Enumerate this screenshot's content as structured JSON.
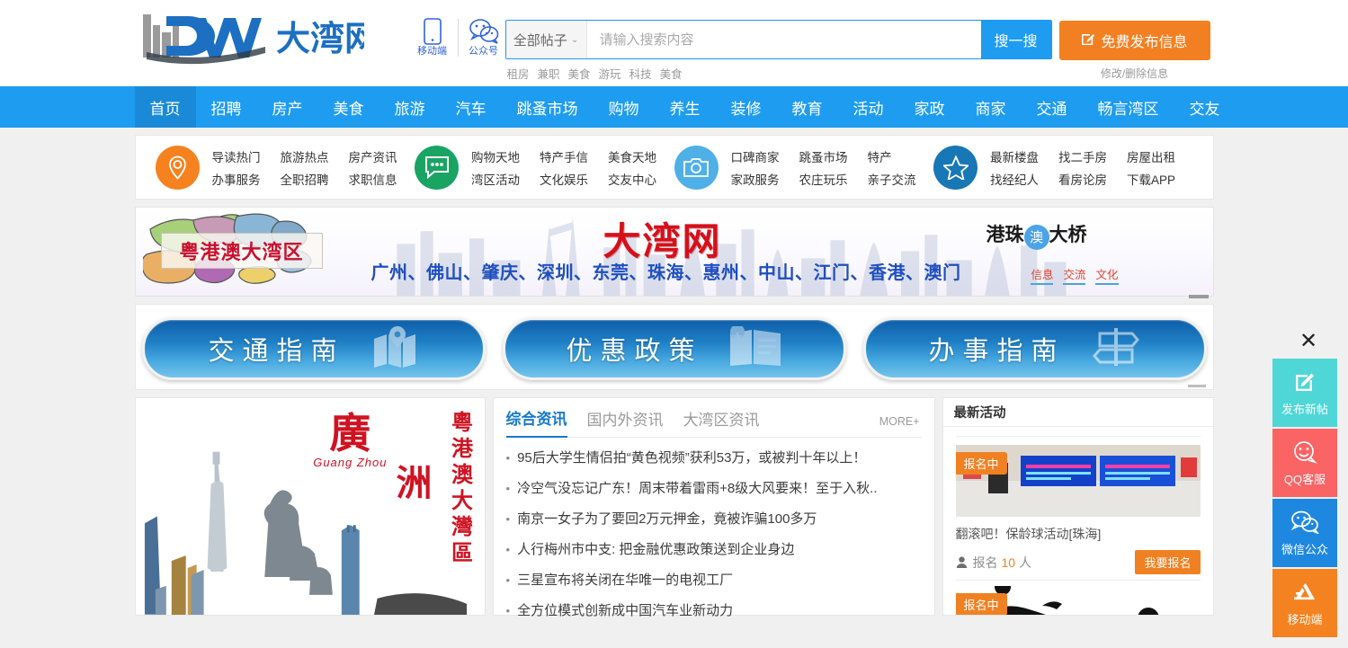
{
  "header": {
    "logo_text": "大湾网",
    "logo_mark": "DW",
    "qr_items": [
      {
        "label": "移动端",
        "icon": "mobile-phone-icon"
      },
      {
        "label": "公众号",
        "icon": "wechat-icon"
      }
    ],
    "search": {
      "category": "全部帖子",
      "placeholder": "请输入搜索内容",
      "value": "",
      "button": "搜一搜",
      "hot_words": [
        "租房",
        "兼职",
        "美食",
        "游玩",
        "科技",
        "美食"
      ]
    },
    "publish": {
      "button": "免费发布信息",
      "sub_link": "修改/删除信息"
    }
  },
  "nav": {
    "items": [
      {
        "label": "首页",
        "active": true
      },
      {
        "label": "招聘",
        "active": false
      },
      {
        "label": "房产",
        "active": false
      },
      {
        "label": "美食",
        "active": false
      },
      {
        "label": "旅游",
        "active": false
      },
      {
        "label": "汽车",
        "active": false
      },
      {
        "label": "跳蚤市场",
        "active": false
      },
      {
        "label": "购物",
        "active": false
      },
      {
        "label": "养生",
        "active": false
      },
      {
        "label": "装修",
        "active": false
      },
      {
        "label": "教育",
        "active": false
      },
      {
        "label": "活动",
        "active": false
      },
      {
        "label": "家政",
        "active": false
      },
      {
        "label": "商家",
        "active": false
      },
      {
        "label": "交通",
        "active": false
      },
      {
        "label": "畅言湾区",
        "active": false
      },
      {
        "label": "交友",
        "active": false
      }
    ]
  },
  "quick_links": {
    "groups": [
      {
        "icon": "location-pin-icon",
        "color": "#f5821f",
        "links": [
          "导读热门",
          "旅游热点",
          "房产资讯",
          "办事服务",
          "全职招聘",
          "求职信息"
        ]
      },
      {
        "icon": "chat-bubble-icon",
        "color": "#19a463",
        "links": [
          "购物天地",
          "特产手信",
          "美食天地",
          "湾区活动",
          "文化娱乐",
          "交友中心"
        ]
      },
      {
        "icon": "camera-icon",
        "color": "#4fb0e8",
        "links": [
          "口碑商家",
          "跳蚤市场",
          "特产",
          "家政服务",
          "农庄玩乐",
          "亲子交流"
        ]
      },
      {
        "icon": "star-icon",
        "color": "#1877b5",
        "links": [
          "最新楼盘",
          "找二手房",
          "房屋出租",
          "找经纪人",
          "看房论房",
          "下载APP"
        ]
      }
    ]
  },
  "banner": {
    "plaque_text": "粤港澳大湾区",
    "title": "大湾网",
    "cities": "广州、佛山、肇庆、深圳、东莞、珠海、惠州、中山、江门、香港、澳门",
    "bridge_brand_1": "港珠",
    "bridge_badge": "澳",
    "bridge_brand_2": "大桥",
    "bridge_links": [
      "信息",
      "交流",
      "文化"
    ]
  },
  "big_buttons": [
    {
      "label": "交通指南",
      "icon": "map-icon"
    },
    {
      "label": "优惠政策",
      "icon": "badge-document-icon"
    },
    {
      "label": "办事指南",
      "icon": "signpost-icon"
    }
  ],
  "left_feature": {
    "city_name": "廣",
    "city_name_2": "洲",
    "pinyin": "Guang Zhou",
    "vertical_text": "粵港澳大灣區"
  },
  "news": {
    "tabs": [
      {
        "label": "综合资讯",
        "active": true
      },
      {
        "label": "国内外资讯",
        "active": false
      },
      {
        "label": "大湾区资讯",
        "active": false
      }
    ],
    "more": "MORE+",
    "items": [
      "95后大学生情侣拍“黄色视频”获利53万，或被判十年以上！",
      "冷空气没忘记广东！周末带着雷雨+8级大风要来！至于入秋..",
      "南京一女子为了要回2万元押金，竟被诈骗100多万",
      "人行梅州市中支: 把金融优惠政策送到企业身边",
      "三星宣布将关闭在华唯一的电视工厂",
      "全方位模式创新成中国汽车业新动力"
    ]
  },
  "activity": {
    "panel_title": "最新活动",
    "cards": [
      {
        "badge": "报名中",
        "title": "翻滚吧！保龄球活动[珠海]",
        "meta_label": "报名",
        "meta_count": "10",
        "meta_unit": "人",
        "button": "我要报名"
      },
      {
        "badge": "报名中",
        "title": "",
        "meta_label": "",
        "meta_count": "",
        "meta_unit": "",
        "button": ""
      }
    ]
  },
  "floatbar": {
    "close": "✕",
    "items": [
      {
        "label": "发布新帖",
        "icon": "compose-icon",
        "color": "#4fd6d6"
      },
      {
        "label": "QQ客服",
        "icon": "smiley-icon",
        "color": "#fa6465"
      },
      {
        "label": "微信公众",
        "icon": "wechat-icon",
        "color": "#1e88e0"
      },
      {
        "label": "移动端",
        "icon": "app-store-icon",
        "color": "#f58220"
      }
    ]
  }
}
